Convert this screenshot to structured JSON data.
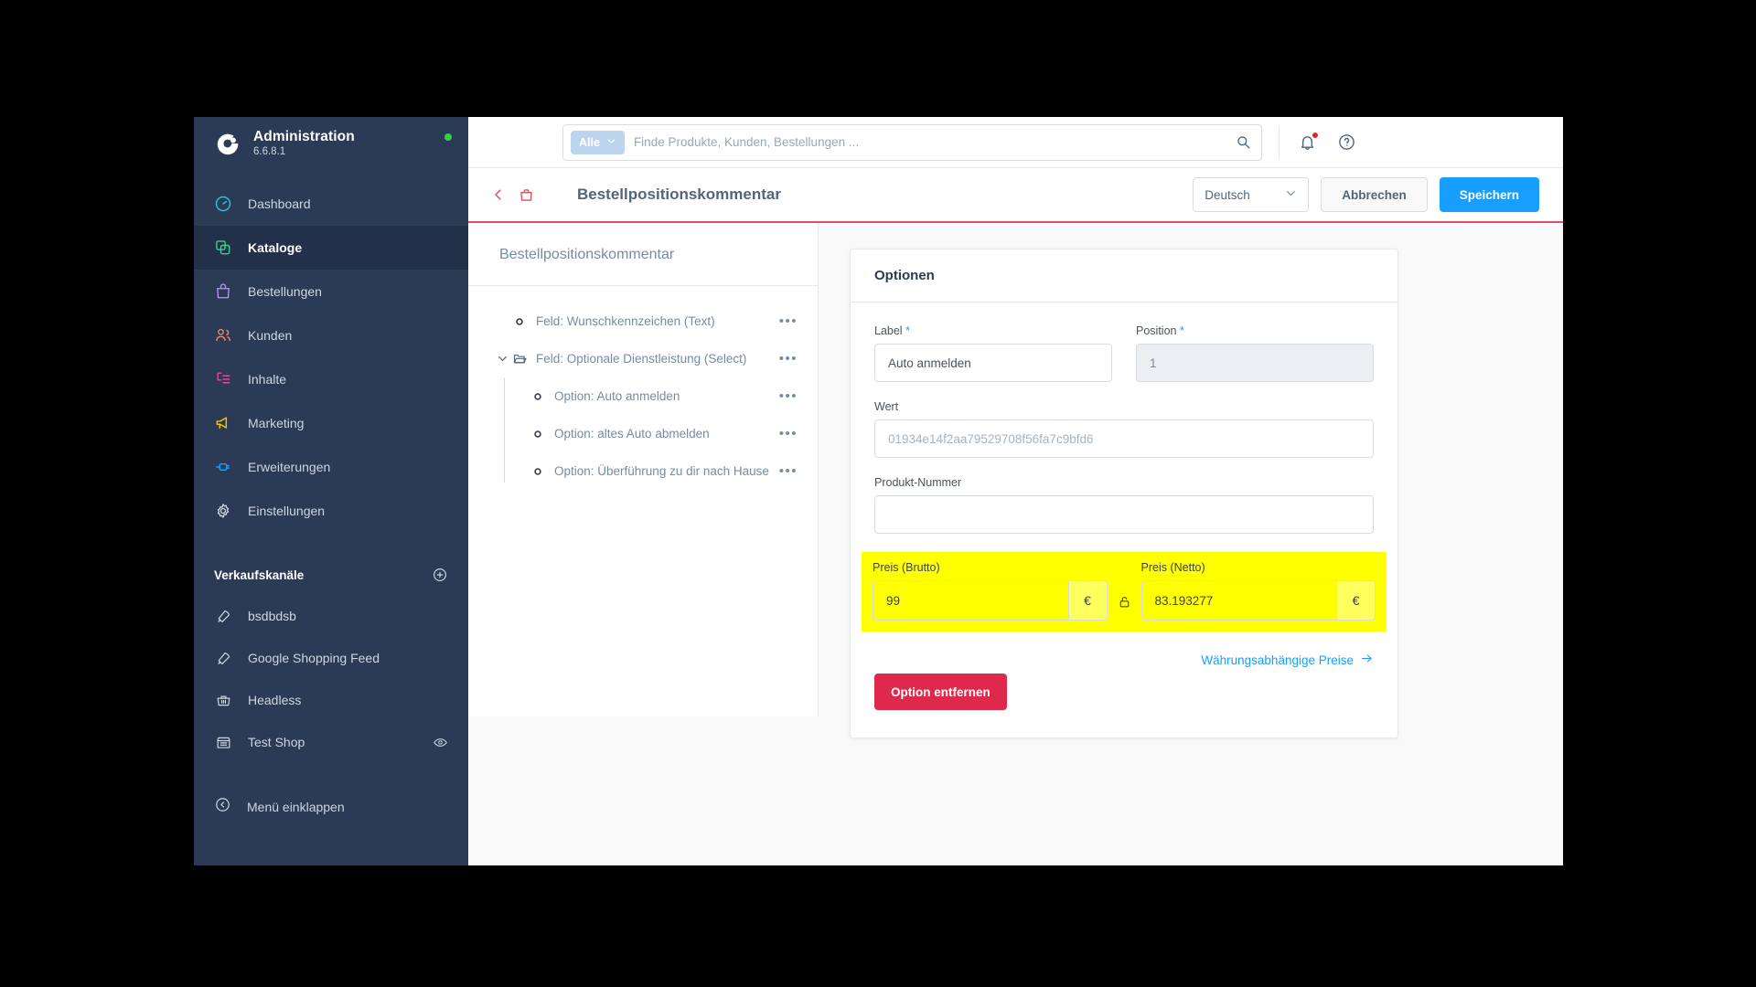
{
  "app": {
    "brand_title": "Administration",
    "version": "6.6.8.1",
    "logo_icon": "shopware-logo-icon",
    "status_icon": "online-status-dot"
  },
  "colors": {
    "sidebar_bg": "#2b3b55",
    "sidebar_active_bg": "#22304a",
    "accent_blue": "#189eff",
    "danger_red": "#de294c",
    "header_underline": "#df4f63",
    "highlight_yellow": "#ffff00",
    "status_green": "#37d046"
  },
  "sidebar": {
    "items": [
      {
        "label": "Dashboard",
        "icon": "dashboard-gauge-icon",
        "color": "#28c6d6",
        "active": false
      },
      {
        "label": "Kataloge",
        "icon": "catalog-copy-icon",
        "color": "#3ecf8e",
        "active": true
      },
      {
        "label": "Bestellungen",
        "icon": "orders-bag-icon",
        "color": "#b18df5",
        "active": false
      },
      {
        "label": "Kunden",
        "icon": "customers-people-icon",
        "color": "#f4845f",
        "active": false
      },
      {
        "label": "Inhalte",
        "icon": "content-pages-icon",
        "color": "#f0409a",
        "active": false
      },
      {
        "label": "Marketing",
        "icon": "marketing-megaphone-icon",
        "color": "#f5c400",
        "active": false
      },
      {
        "label": "Erweiterungen",
        "icon": "extensions-plug-icon",
        "color": "#189eff",
        "active": false
      },
      {
        "label": "Einstellungen",
        "icon": "settings-gear-icon",
        "color": "#cdd5e0",
        "active": false
      }
    ],
    "sales_channels_heading": "Verkaufskanäle",
    "add_channel_icon": "plus-circle-icon",
    "channels": [
      {
        "label": "bsdbdsb",
        "icon": "rocket-icon",
        "has_eye": false
      },
      {
        "label": "Google Shopping Feed",
        "icon": "rocket-icon",
        "has_eye": false
      },
      {
        "label": "Headless",
        "icon": "headless-basket-icon",
        "has_eye": false
      },
      {
        "label": "Test Shop",
        "icon": "storefront-icon",
        "has_eye": true,
        "eye_icon": "eye-icon"
      }
    ],
    "collapse_label": "Menü einklappen",
    "collapse_icon": "chevron-circle-left-icon"
  },
  "topbar": {
    "search_scope_label": "Alle",
    "search_scope_icon": "chevron-down-icon",
    "search_placeholder": "Finde Produkte, Kunden, Bestellungen ...",
    "search_value": "",
    "search_icon": "search-icon",
    "notifications_icon": "bell-icon",
    "notifications_badge": true,
    "help_icon": "question-circle-icon"
  },
  "pageheader": {
    "back_icon": "chevron-left-icon",
    "entity_icon": "bag-icon",
    "title": "Bestellpositionskommentar",
    "language_value": "Deutsch",
    "language_caret_icon": "chevron-down-icon",
    "cancel_label": "Abbrechen",
    "save_label": "Speichern"
  },
  "tree": {
    "panel_title": "Bestellpositionskommentar",
    "more_icon": "ellipsis-icon",
    "nodes": [
      {
        "label": "Feld: Wunschkennzeichen (Text)",
        "level": 1,
        "icon": "dot-node-icon",
        "expandable": false
      },
      {
        "label": "Feld: Optionale Dienstleistung (Select)",
        "level": 1,
        "icon": "folder-open-icon",
        "expandable": true,
        "expanded": true,
        "caret_icon": "chevron-down-icon"
      },
      {
        "label": "Option: Auto anmelden",
        "level": 2,
        "icon": "dot-node-icon",
        "expandable": false
      },
      {
        "label": "Option: altes Auto abmelden",
        "level": 2,
        "icon": "dot-node-icon",
        "expandable": false
      },
      {
        "label": "Option: Überführung zu dir nach Hause",
        "level": 2,
        "icon": "dot-node-icon",
        "expandable": false
      }
    ]
  },
  "options_card": {
    "title": "Optionen",
    "label_field": {
      "label": "Label",
      "required_marker": "*",
      "value": "Auto anmelden"
    },
    "position_field": {
      "label": "Position",
      "required_marker": "*",
      "value": "1",
      "disabled": true
    },
    "wert_field": {
      "label": "Wert",
      "value": "01934e14f2aa79529708f56fa7c9bfd6"
    },
    "produkt_nummer_field": {
      "label": "Produkt-Nummer",
      "value": "",
      "placeholder": ""
    },
    "price_gross": {
      "label": "Preis (Brutto)",
      "value": "99",
      "currency_symbol": "€"
    },
    "price_net": {
      "label": "Preis (Netto)",
      "value": "83.193277",
      "currency_symbol": "€"
    },
    "lock_icon": "unlocked-padlock-icon",
    "highlighted": true,
    "remove_button_label": "Option entfernen",
    "currency_link_label": "Währungsabhängige Preise",
    "currency_link_arrow": "arrow-right-icon"
  }
}
